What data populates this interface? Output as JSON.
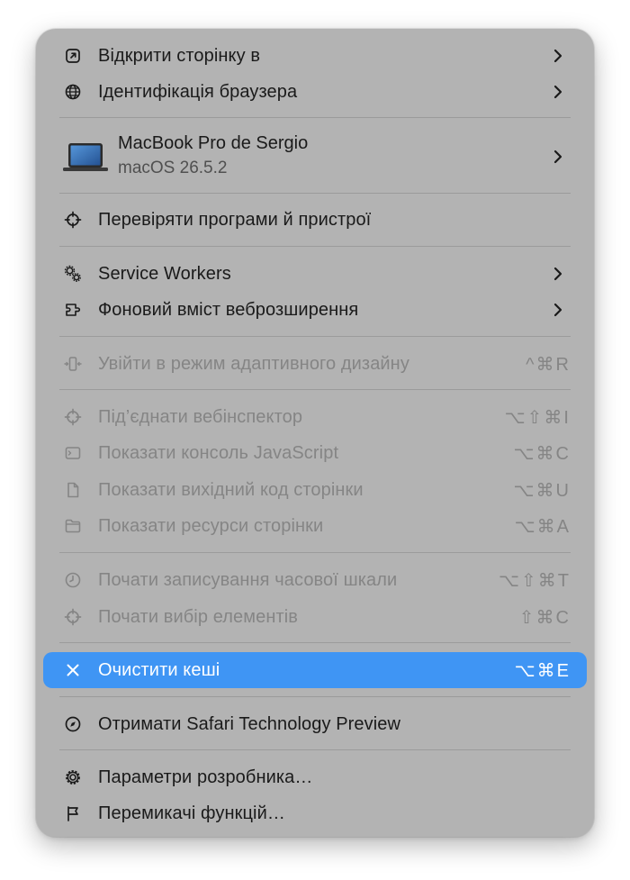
{
  "menu": {
    "open_page_in": "Відкрити сторінку в",
    "browser_id": "Ідентифікація браузера",
    "device": {
      "name": "MacBook Pro de Sergio",
      "os": "macOS 26.5.2"
    },
    "inspect_apps": "Перевіряти програми й пристрої",
    "service_workers": "Service Workers",
    "extension_bg": "Фоновий вміст веброзширення",
    "responsive_mode": {
      "label": "Увійти в режим адаптивного дизайну",
      "shortcut": "^⌘R"
    },
    "connect_inspector": {
      "label": "Під’єднати вебінспектор",
      "shortcut": "⌥⇧⌘I"
    },
    "js_console": {
      "label": "Показати консоль JavaScript",
      "shortcut": "⌥⌘C"
    },
    "page_source": {
      "label": "Показати вихідний код сторінки",
      "shortcut": "⌥⌘U"
    },
    "page_resources": {
      "label": "Показати ресурси сторінки",
      "shortcut": "⌥⌘A"
    },
    "timeline": {
      "label": "Почати записування часової шкали",
      "shortcut": "⌥⇧⌘T"
    },
    "element_select": {
      "label": "Почати вибір елементів",
      "shortcut": "⇧⌘C"
    },
    "clear_caches": {
      "label": "Очистити кеші",
      "shortcut": "⌥⌘E"
    },
    "get_stp": "Отримати Safari Technology Preview",
    "dev_settings": "Параметри розробника…",
    "feature_flags": "Перемикачі функцій…"
  },
  "colors": {
    "menu_bg": "#b3b3b3",
    "selected": "#3f95f4",
    "text": "#1a1a1a",
    "disabled_text": "#858585"
  },
  "icons": [
    "open-external-icon",
    "globe-icon",
    "laptop-icon",
    "crosshair-icon",
    "gears-icon",
    "extension-icon",
    "responsive-icon",
    "terminal-icon",
    "document-icon",
    "folder-icon",
    "clock-icon",
    "close-icon",
    "compass-icon",
    "gear-icon",
    "flag-icon",
    "chevron-right-icon"
  ]
}
